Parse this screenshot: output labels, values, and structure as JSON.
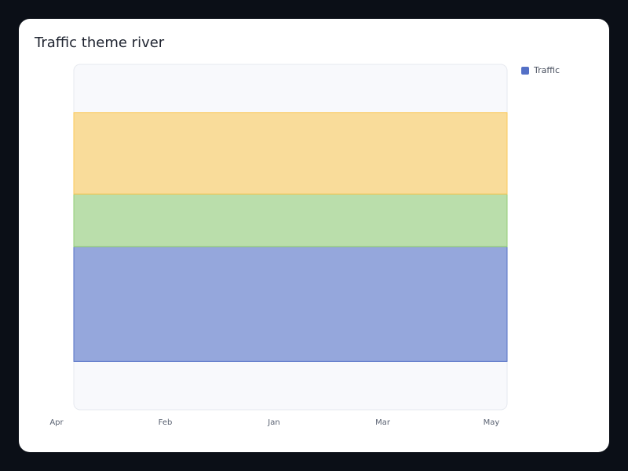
{
  "title": "Traffic theme river",
  "legend": [
    {
      "name": "Traffic",
      "color": "#5470c6"
    }
  ],
  "colors": {
    "band_0": "#5470c6",
    "band_1": "#91cc75",
    "band_2": "#fac858"
  },
  "chart_data": {
    "type": "area",
    "subtype": "themeRiver",
    "x": [
      "Apr",
      "Feb",
      "Jan",
      "Mar",
      "May"
    ],
    "series": [
      {
        "name": "Traffic",
        "values": [
          100,
          100,
          100,
          100,
          100
        ]
      },
      {
        "values": [
          46,
          46,
          46,
          46,
          46
        ]
      },
      {
        "values": [
          71,
          71,
          71,
          71,
          71
        ]
      }
    ],
    "stack_baseline": "centered",
    "grid": false,
    "legend_position": "top-right"
  }
}
